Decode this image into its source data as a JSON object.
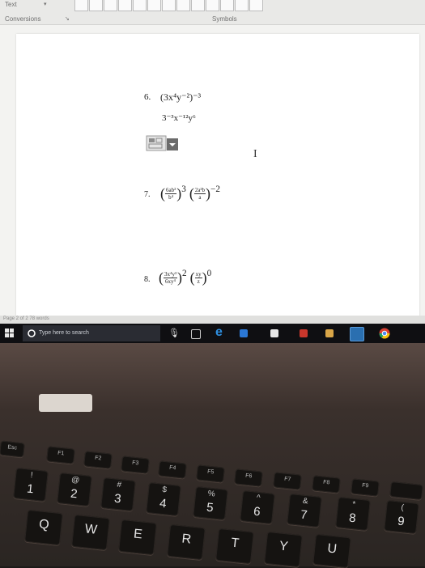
{
  "word": {
    "ribbon": {
      "text_label": "Text",
      "conversions_label": "Conversions",
      "symbols_label": "Symbols"
    },
    "questions": [
      {
        "number": "6.",
        "expr": "(3x⁴y⁻²)⁻³",
        "answer": "3⁻³x⁻¹²y⁶"
      },
      {
        "number": "7.",
        "expr_a_num": "6ab²",
        "expr_a_den": "b⁴",
        "exp_a": "3",
        "expr_b_num": "2a²b",
        "expr_b_den": "a",
        "exp_b": "−2"
      },
      {
        "number": "8.",
        "expr_a_num": "3x⁴y³",
        "expr_a_den": "6xy⁴",
        "exp_a": "2",
        "expr_b_num": "xy",
        "expr_b_den": "z",
        "exp_b": "0"
      }
    ],
    "status_text": "Page 2 of 2   78 words"
  },
  "taskbar": {
    "search_placeholder": "Type here to search"
  },
  "keyboard": {
    "fn_row": [
      "Esc",
      "F1",
      "F2",
      "F3",
      "F4",
      "F5",
      "F6",
      "F7",
      "F8",
      "F9"
    ],
    "number_row": [
      {
        "main": "1",
        "shift": "!"
      },
      {
        "main": "2",
        "shift": "@"
      },
      {
        "main": "3",
        "shift": "#"
      },
      {
        "main": "4",
        "shift": "$"
      },
      {
        "main": "5",
        "shift": "%"
      },
      {
        "main": "6",
        "shift": "^"
      },
      {
        "main": "7",
        "shift": "&"
      },
      {
        "main": "8",
        "shift": "*"
      },
      {
        "main": "9",
        "shift": "("
      }
    ],
    "letter_row": [
      "Q",
      "W",
      "E",
      "R",
      "T",
      "Y",
      "U"
    ]
  },
  "colors": {
    "screen_bg": "#f3f3f1",
    "taskbar": "#0f0f12",
    "laptop_body": "#3a302c"
  }
}
